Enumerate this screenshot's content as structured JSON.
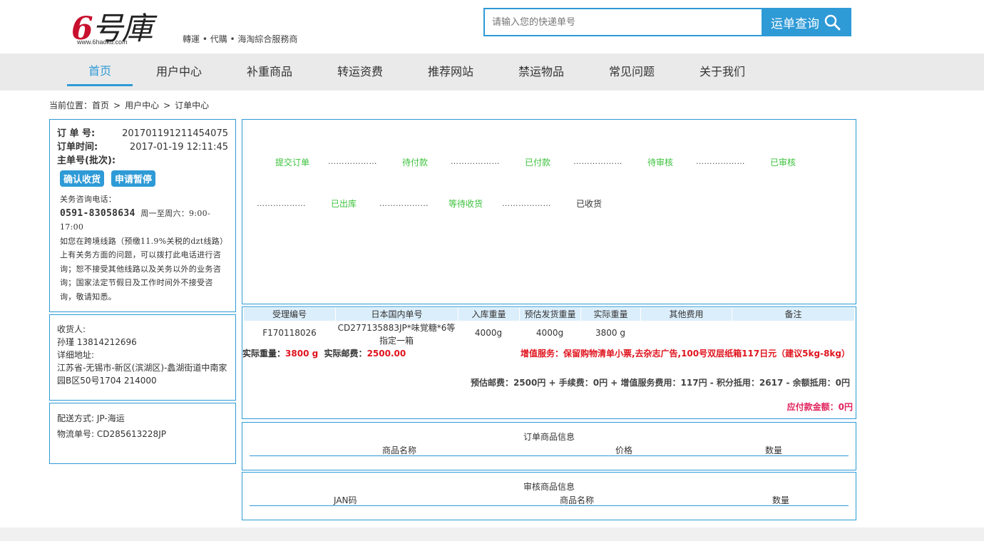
{
  "header": {
    "logo_text": "6号庫",
    "logo_url": "www.6haoku.com",
    "tagline": "轉運 • 代購 • 海淘綜合服務商",
    "search_placeholder": "请输入您的快递单号",
    "search_button": "运单查询"
  },
  "nav": {
    "items": [
      "首页",
      "用户中心",
      "补重商品",
      "转运资费",
      "推荐网站",
      "禁运物品",
      "常见问题",
      "关于我们"
    ],
    "active_index": 0
  },
  "breadcrumb": {
    "prefix": "当前位置：",
    "items": [
      "首页",
      "用户中心",
      "订单中心"
    ],
    "separator": ">"
  },
  "order": {
    "order_no_label": "订 单 号:",
    "order_no": "201701191211454075",
    "order_time_label": "订单时间:",
    "order_time": "2017-01-19 12:11:45",
    "batch_label": "主单号(批次):",
    "btn_confirm": "确认收货",
    "btn_pause": "申请暂停",
    "notice_title": "关务咨询电话：",
    "phone": "0591-83058634",
    "hours_a": "周一至周六：9:00-",
    "hours_b": "17:00",
    "notice_body": "如您在跨境线路（预缴11.9%关税的dzt线路）上有关务方面的问题，可以拨打此电话进行咨询；恕不接受其他线路以及关务以外的业务咨询；国家法定节假日及工作时间外不接受咨询，敬请知悉。"
  },
  "receiver": {
    "label": "收货人:",
    "name_phone": "孙瑾 13814212696",
    "address_label": "详细地址:",
    "address": "江苏省-无锡市-新区(滨湖区)-蠡湖街道中南家园B区50号1704 214000"
  },
  "delivery": {
    "method": "配送方式: JP-海运",
    "tracking": "物流单号: CD285613228JP"
  },
  "steps": {
    "row1": [
      "提交订单",
      "待付款",
      "已付款",
      "待审核",
      "已审核"
    ],
    "row2": [
      "已出库",
      "等待收货",
      "已收货"
    ],
    "dots": "………………"
  },
  "shipment": {
    "headers": [
      "受理编号",
      "日本国内单号",
      "入库重量",
      "预估发货重量",
      "实际重量",
      "其他费用",
      "备注"
    ],
    "row": {
      "id": "F170118026",
      "jp_no_a": "CD277135883JP*味覚糖*6等",
      "jp_no_b": "指定一箱",
      "in_weight": "4000g",
      "est_weight": "4000g",
      "actual_weight": "3800 g"
    },
    "actual_weight_label": "实际重量：",
    "actual_weight_val": "3800 g",
    "actual_postage_label": "实际邮费：",
    "actual_postage_val": "2500.00",
    "value_added": "增值服务：保留购物清单小票,去杂志广告,100号双层纸箱117日元（建议5kg-8kg）",
    "estimate": "预估邮费：2500円 + 手续费：0円 + 增值服务费用：117円 - 积分抵用：2617 - 余额抵用：0円",
    "payable": "应付款金额：0円"
  },
  "goods": {
    "title": "订单商品信息",
    "cols": [
      "商品名称",
      "价格",
      "数量"
    ]
  },
  "audit": {
    "title": "审核商品信息",
    "cols": [
      "JAN码",
      "商品名称",
      "数量"
    ]
  },
  "colors": {
    "accent": "#2e9ad6",
    "step_done": "#3cc13c",
    "warn": "#e0141e"
  }
}
